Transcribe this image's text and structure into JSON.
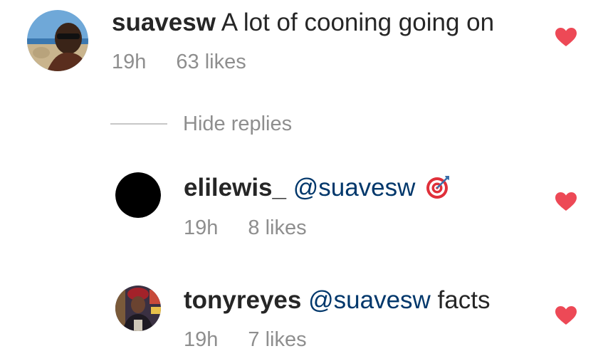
{
  "comments": [
    {
      "username": "suavesw",
      "text": "A lot of cooning going on",
      "time": "19h",
      "likes": "63 likes",
      "avatar_icon": "user-photo-avatar",
      "liked": true
    }
  ],
  "hide_replies_label": "Hide replies",
  "replies": [
    {
      "username": "elilewis_",
      "mention": "@suavesw",
      "text": "",
      "emoji": "direct-hit-emoji",
      "time": "19h",
      "likes": "8 likes",
      "avatar_icon": "black-circle-avatar",
      "liked": true
    },
    {
      "username": "tonyreyes",
      "mention": "@suavesw",
      "text": "facts",
      "time": "19h",
      "likes": "7 likes",
      "avatar_icon": "user-photo-avatar",
      "liked": true
    }
  ],
  "colors": {
    "heart": "#ed4956",
    "mention": "#00376b",
    "meta": "#8e8e8e",
    "text": "#262626"
  }
}
